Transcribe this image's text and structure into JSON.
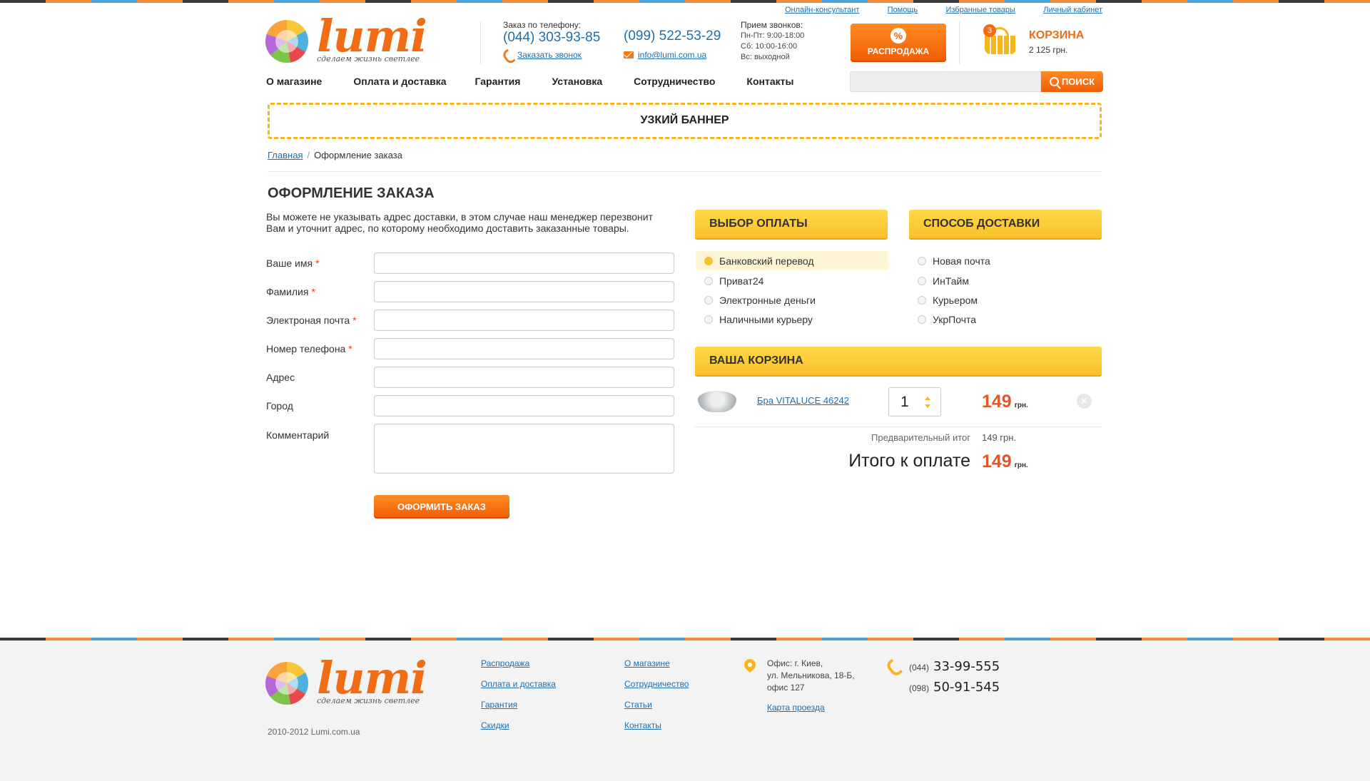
{
  "toplinks": [
    "Онлайн-консультант",
    "Помощь",
    "Избранные товары",
    "Личный кабинет"
  ],
  "logo": {
    "word": "lumi",
    "tagline": "сделаем жизнь светлее"
  },
  "contacts": {
    "phone_label": "Заказ по телефону:",
    "phone1": "(044) 303-93-85",
    "phone2": "(099) 522-53-29",
    "callback": "Заказать звонок",
    "email": "info@lumi.com.ua"
  },
  "hours": {
    "title": "Прием звонков:",
    "line1": "Пн-Пт: 9:00-18:00",
    "line2": "Сб: 10:00-16:00",
    "line3": "Вс: выходной"
  },
  "sale": {
    "icon": "percent-icon",
    "label": "РАСПРОДАЖА"
  },
  "cart": {
    "count": "3",
    "title": "КОРЗИНА",
    "sum": "2 125 грн."
  },
  "nav": [
    "О магазине",
    "Оплата и доставка",
    "Гарантия",
    "Установка",
    "Сотрудничество",
    "Контакты"
  ],
  "search": {
    "placeholder": "",
    "button": "ПОИСК"
  },
  "banner": "УЗКИЙ БАННЕР",
  "breadcrumb": {
    "home": "Главная",
    "sep": "/",
    "current": "Оформление заказа"
  },
  "page": {
    "title": "ОФОРМЛЕНИЕ ЗАКАЗА",
    "note": "Вы можете не указывать адрес доставки, в этом случае наш менеджер перезвонит Вам и уточнит адрес, по которому необходимо доставить заказанные товары."
  },
  "form": {
    "required_mark": "*",
    "fields": [
      {
        "label": "Ваше имя",
        "required": true,
        "value": ""
      },
      {
        "label": "Фамилия",
        "required": true,
        "value": ""
      },
      {
        "label": "Электроная почта",
        "required": true,
        "value": ""
      },
      {
        "label": "Номер телефона",
        "required": true,
        "value": ""
      },
      {
        "label": "Адрес",
        "required": false,
        "value": ""
      },
      {
        "label": "Город",
        "required": false,
        "value": ""
      },
      {
        "label": "Комментарий",
        "required": false,
        "value": ""
      }
    ],
    "submit": "ОФОРМИТЬ ЗАКАЗ"
  },
  "payment": {
    "title": "ВЫБОР ОПЛАТЫ",
    "options": [
      "Банковский перевод",
      "Приват24",
      "Электронные деньги",
      "Наличными курьеру"
    ],
    "selected": "Банковский перевод"
  },
  "delivery": {
    "title": "СПОСОБ ДОСТАВКИ",
    "options": [
      "Новая почта",
      "ИнТайм",
      "Курьером",
      "УкрПочта"
    ]
  },
  "basket": {
    "title": "ВАША КОРЗИНА",
    "item": {
      "name": "Бра VITALUCE 46242",
      "qty": "1",
      "price": "149",
      "currency": "грн."
    },
    "subtotal_label": "Предварительный итог",
    "subtotal_value": "149 грн.",
    "total_label": "Итого к оплате",
    "total_value": "149",
    "total_currency": "грн."
  },
  "footer": {
    "copyright": "2010-2012 Lumi.com.ua",
    "col1": [
      "Распродажа",
      "Оплата и доставка",
      "Гарантия",
      "Скидки"
    ],
    "col2": [
      "О магазине",
      "Сотрудничество",
      "Статьи",
      "Контакты"
    ],
    "address": {
      "line1": "Офис: г. Киев,",
      "line2": "ул. Мельникова, 18-Б,",
      "line3": "офис 127",
      "map": "Карта проезда"
    },
    "phones": [
      {
        "code": "(044)",
        "number": "33-99-555"
      },
      {
        "code": "(098)",
        "number": "50-91-545"
      }
    ]
  },
  "colors": {
    "accent": "#f06d16",
    "yellow": "#f8c12a",
    "link": "#1d6fae"
  }
}
